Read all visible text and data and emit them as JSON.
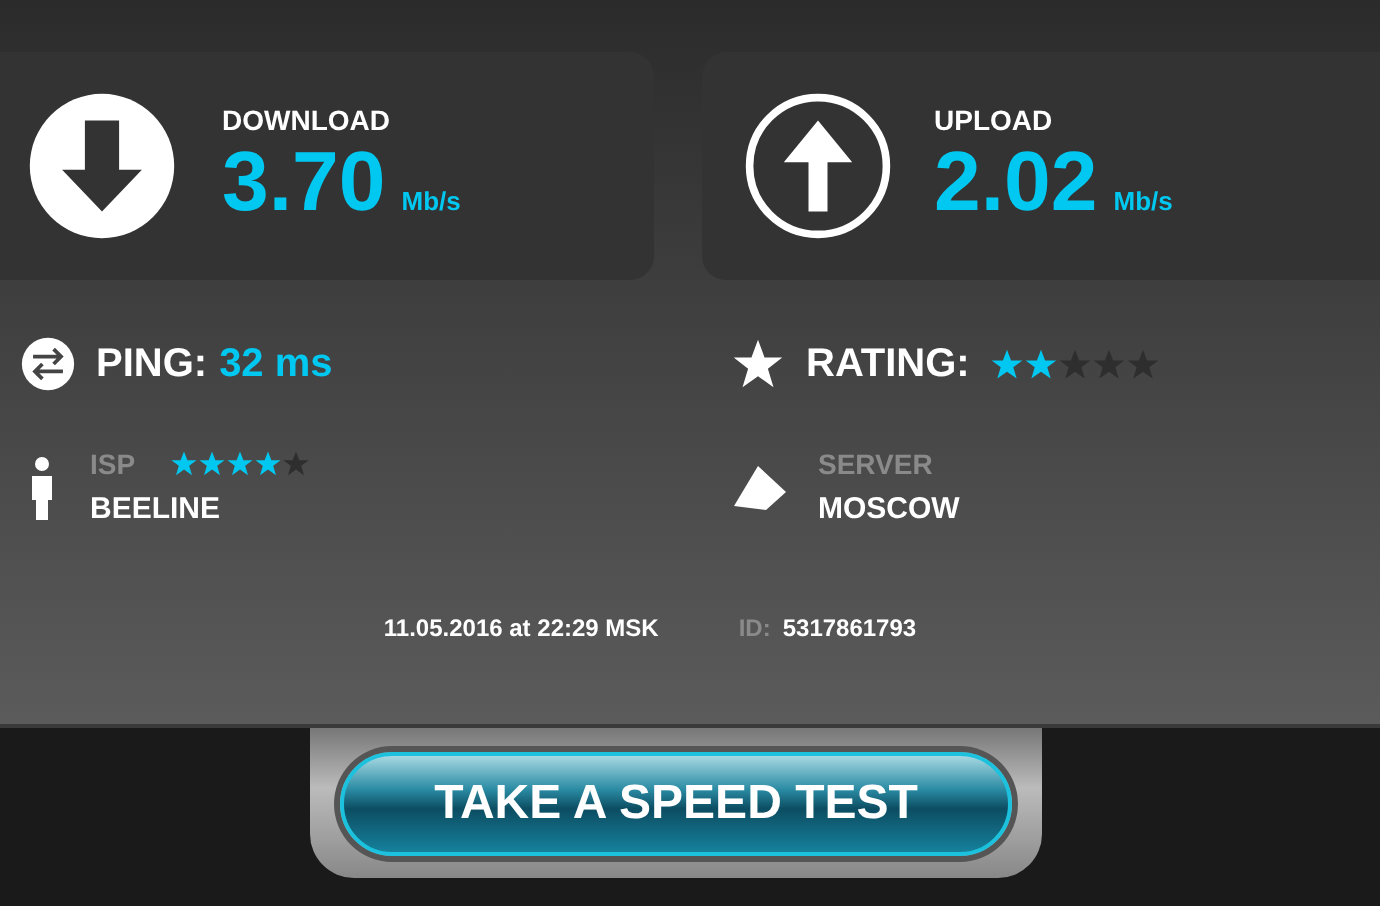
{
  "results": [
    {
      "kind": "download",
      "label": "DOWNLOAD",
      "value": "3.70",
      "unit": "Mb/s"
    },
    {
      "kind": "upload",
      "label": "UPLOAD",
      "value": "2.02",
      "unit": "Mb/s"
    }
  ],
  "ping": {
    "label": "PING:",
    "value": "32 ms"
  },
  "rating": {
    "label": "RATING:",
    "stars": 2
  },
  "isp": {
    "label": "ISP",
    "stars": 4,
    "name": "BEELINE"
  },
  "server": {
    "label": "SERVER",
    "name": "MOSCOW"
  },
  "timestamp": "11.05.2016 at 22:29 MSK",
  "test_id": {
    "label": "ID:",
    "value": "5317861793"
  },
  "button": "TAKE A SPEED TEST"
}
